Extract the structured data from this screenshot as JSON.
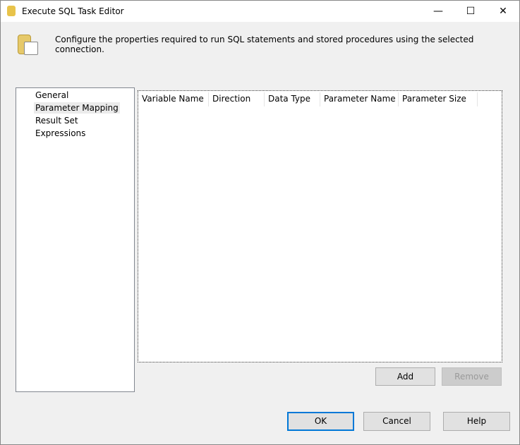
{
  "window": {
    "title": "Execute SQL Task Editor",
    "minimize": "—",
    "maximize": "☐",
    "close": "✕"
  },
  "description": "Configure the properties required to run SQL statements and stored procedures using the selected connection.",
  "nav": {
    "items": [
      "General",
      "Parameter Mapping",
      "Result Set",
      "Expressions"
    ],
    "selected": "Parameter Mapping"
  },
  "grid": {
    "columns": [
      "Variable Name",
      "Direction",
      "Data Type",
      "Parameter Name",
      "Parameter Size"
    ],
    "rows": []
  },
  "buttons": {
    "add": "Add",
    "remove": "Remove",
    "ok": "OK",
    "cancel": "Cancel",
    "help": "Help"
  }
}
